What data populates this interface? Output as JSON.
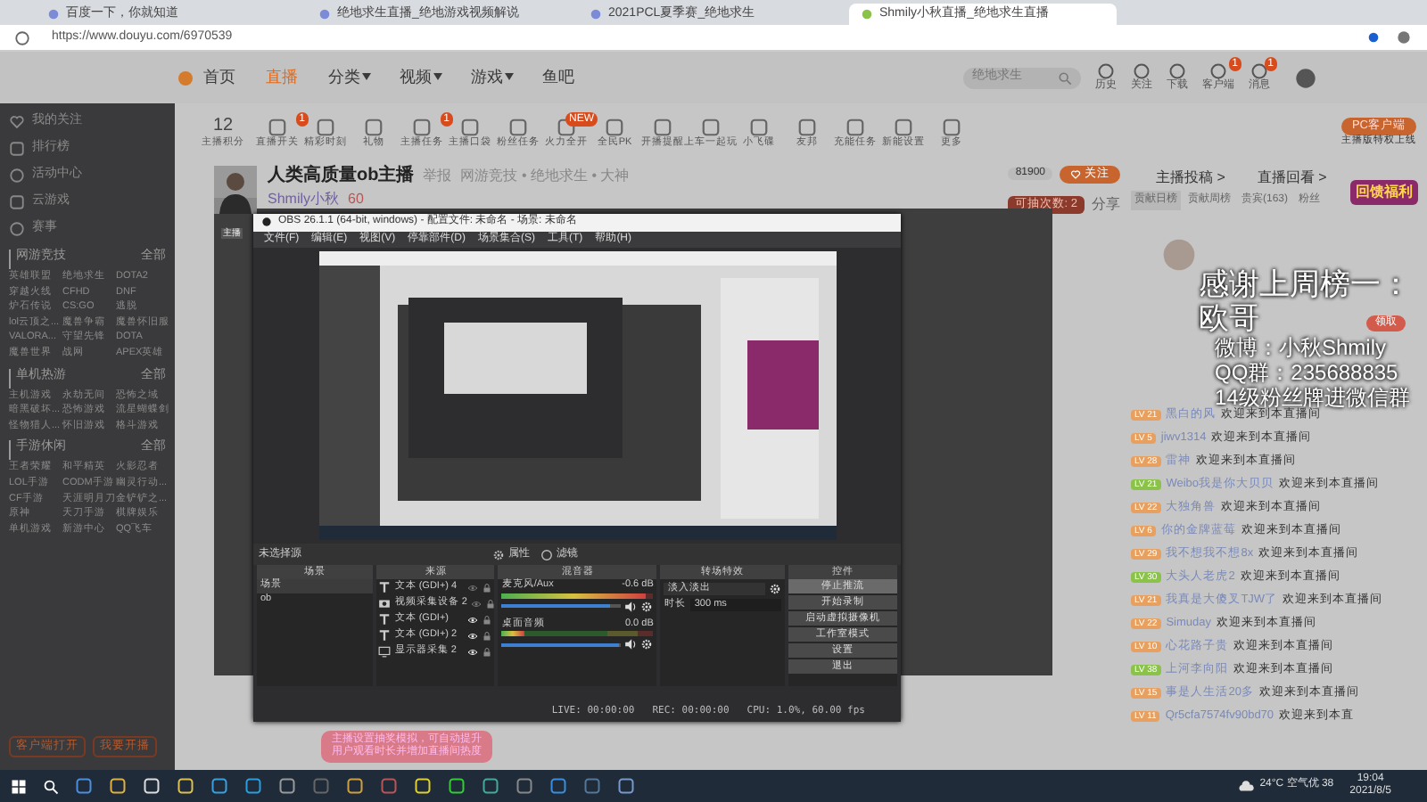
{
  "browser": {
    "tabs": [
      {
        "title": "百度一下，你就知道",
        "selected": false
      },
      {
        "title": "绝地求生直播_绝地游戏视频解说",
        "selected": false
      },
      {
        "title": "2021PCL夏季赛_绝地求生",
        "selected": false
      },
      {
        "title": "Shmily小秋直播_绝地求生直播",
        "selected": true
      }
    ],
    "url": "https://www.douyu.com/6970539"
  },
  "header": {
    "nav": [
      {
        "label": "首页",
        "selected": false,
        "dropdown": false
      },
      {
        "label": "直播",
        "selected": true,
        "dropdown": false
      },
      {
        "label": "分类",
        "selected": false,
        "dropdown": true
      },
      {
        "label": "视频",
        "selected": false,
        "dropdown": true
      },
      {
        "label": "游戏",
        "selected": false,
        "dropdown": true
      },
      {
        "label": "鱼吧",
        "selected": false,
        "dropdown": false
      }
    ],
    "search_placeholder": "绝地求生",
    "actions": [
      {
        "label": "历史"
      },
      {
        "label": "关注"
      },
      {
        "label": "下载"
      },
      {
        "label": "客户端",
        "badge": "1"
      },
      {
        "label": "消息",
        "badge": "1"
      }
    ]
  },
  "sidebar": {
    "links": [
      "我的关注",
      "排行榜",
      "活动中心",
      "云游戏",
      "赛事"
    ],
    "sections": [
      {
        "title": "网游竞技",
        "more": "全部",
        "items": [
          "英雄联盟",
          "绝地求生",
          "DOTA2",
          "穿越火线",
          "CFHD",
          "DNF",
          "炉石传说",
          "CS:GO",
          "逃脱",
          "lol云顶之...",
          "魔兽争霸",
          "魔兽怀旧服",
          "VALORA...",
          "守望先锋",
          "DOTA",
          "魔兽世界",
          "战网",
          "APEX英雄"
        ]
      },
      {
        "title": "单机热游",
        "more": "全部",
        "items": [
          "主机游戏",
          "永劫无间",
          "恐怖之域",
          "暗黑破坏...",
          "恐怖游戏",
          "流星蝴蝶剑",
          "怪物猎人...",
          "怀旧游戏",
          "格斗游戏"
        ]
      },
      {
        "title": "手游休闲",
        "more": "全部",
        "items": [
          "王者荣耀",
          "和平精英",
          "火影忍者",
          "LOL手游",
          "CODM手游",
          "幽灵行动...",
          "CF手游",
          "天涯明月刀",
          "金铲铲之...",
          "原神",
          "天刀手游",
          "棋牌娱乐",
          "单机游戏",
          "新游中心",
          "QQ飞车"
        ]
      }
    ],
    "buttons": [
      "客户端打开",
      "我要开播"
    ]
  },
  "toolbar": {
    "score": "12",
    "score_label": "主播积分",
    "tools": [
      {
        "label": "直播开关",
        "badge": "1"
      },
      {
        "label": "精彩时刻"
      },
      {
        "label": "礼物"
      },
      {
        "label": "主播任务",
        "badge": "1"
      },
      {
        "label": "主播口袋"
      },
      {
        "label": "粉丝任务"
      },
      {
        "label": "火力全开",
        "badge": "NEW"
      },
      {
        "label": "全民PK"
      },
      {
        "label": "开播提醒"
      },
      {
        "label": "上车一起玩"
      },
      {
        "label": "小飞碟"
      },
      {
        "label": "友邦"
      },
      {
        "label": "充能任务"
      },
      {
        "label": "新能设置"
      },
      {
        "label": "更多"
      }
    ],
    "client_button": "PC客户端",
    "client_note": "主播版特权上线"
  },
  "streamer": {
    "name": "人类高质量ob主播",
    "report": "举报",
    "category": "网游竞技 • 绝地求生 • 大神",
    "anchor": "Shmily小秋",
    "level": "60",
    "avatar_label": "主播",
    "follow_count": "81900",
    "follow_button": "关注",
    "lottery_button": "可抽次数: 2",
    "share": "分享"
  },
  "obs": {
    "title": "OBS 26.1.1 (64-bit, windows) - 配置文件: 未命名 - 场景: 未命名",
    "menu": [
      "文件(F)",
      "编辑(E)",
      "视图(V)",
      "停靠部件(D)",
      "场景集合(S)",
      "工具(T)",
      "帮助(H)"
    ],
    "source_bar": {
      "label": "未选择源",
      "properties": "属性",
      "filters": "滤镜"
    },
    "docks": {
      "scenes": {
        "title": "场景",
        "items": [
          {
            "label": "场景",
            "selected": true
          },
          {
            "label": "ob",
            "selected": false
          }
        ]
      },
      "sources": {
        "title": "来源",
        "items": [
          {
            "label": "文本 (GDI+) 4",
            "kind": "text",
            "visible": false
          },
          {
            "label": "视频采集设备 2",
            "kind": "camera",
            "visible": false
          },
          {
            "label": "文本 (GDI+)",
            "kind": "text",
            "visible": true
          },
          {
            "label": "文本 (GDI+) 2",
            "kind": "text",
            "visible": true
          },
          {
            "label": "显示器采集 2",
            "kind": "monitor",
            "visible": true
          }
        ]
      },
      "mixer": {
        "title": "混音器",
        "channels": [
          {
            "name": "麦克风/Aux",
            "reading": "-0.6 dB",
            "meter": {
              "level": 0.95
            },
            "volume": {
              "level": 0.9
            }
          },
          {
            "name": "桌面音频",
            "reading": "0.0 dB",
            "meter": {
              "level": 0.15
            },
            "volume": {
              "level": 0.98
            }
          }
        ]
      },
      "transitions": {
        "title": "转场特效",
        "transition": "淡入淡出",
        "duration_label": "时长",
        "duration": "300 ms"
      },
      "controls": {
        "title": "控件",
        "buttons": [
          {
            "label": "停止推流",
            "active": true
          },
          {
            "label": "开始录制",
            "active": false
          },
          {
            "label": "启动虚拟摄像机",
            "active": false
          },
          {
            "label": "工作室模式",
            "active": false
          },
          {
            "label": "设置",
            "active": false
          },
          {
            "label": "退出",
            "active": false
          }
        ]
      }
    },
    "status": {
      "live": "LIVE: 00:00:00",
      "rec": "REC: 00:00:00",
      "cpu": "CPU: 1.0%, 60.00 fps"
    }
  },
  "tooltip": [
    "主播设置抽奖模拟，可自动提升",
    "用户观看时长并增加直播间热度"
  ],
  "chat": {
    "links": [
      "主播投稿 >",
      "直播回看 >"
    ],
    "tabs": [
      {
        "label": "贡献日榜",
        "selected": true
      },
      {
        "label": "贡献周榜",
        "selected": false
      },
      {
        "label": "贵宾(163)",
        "selected": false
      },
      {
        "label": "粉丝",
        "selected": false
      }
    ],
    "messages": [
      {
        "level": "LV 21",
        "color": "#e8a060",
        "name": "黑白的风",
        "text": "欢迎来到本直播间"
      },
      {
        "level": "LV 5",
        "color": "#e8a060",
        "name": "jiwv1314",
        "text": "欢迎来到本直播间"
      },
      {
        "level": "LV 28",
        "color": "#e8a060",
        "name": "雷神",
        "text": "欢迎来到本直播间"
      },
      {
        "level": "LV 21",
        "color": "#8bc34a",
        "name": "Weibo我是你大贝贝",
        "text": "欢迎来到本直播间"
      },
      {
        "level": "LV 22",
        "color": "#e8a060",
        "name": "大独角兽",
        "text": "欢迎来到本直播间"
      },
      {
        "level": "LV 6",
        "color": "#e8a060",
        "name": "你的金牌蓝莓",
        "text": "欢迎来到本直播间"
      },
      {
        "level": "LV 29",
        "color": "#e8a060",
        "name": "我不想我不想8x",
        "text": "欢迎来到本直播间"
      },
      {
        "level": "LV 30",
        "color": "#8bc34a",
        "name": "大头人老虎2",
        "text": "欢迎来到本直播间"
      },
      {
        "level": "LV 21",
        "color": "#e8a060",
        "name": "我真是大傻叉TJW了",
        "text": "欢迎来到本直播间"
      },
      {
        "level": "LV 22",
        "color": "#e8a060",
        "name": "Simuday",
        "text": "欢迎来到本直播间"
      },
      {
        "level": "LV 10",
        "color": "#e8a060",
        "name": "心花路子贵",
        "text": "欢迎来到本直播间"
      },
      {
        "level": "LV 38",
        "color": "#8bc34a",
        "name": "上河李向阳",
        "text": "欢迎来到本直播间"
      },
      {
        "level": "LV 15",
        "color": "#e8a060",
        "name": "事是人生活20多",
        "text": "欢迎来到本直播间"
      },
      {
        "level": "LV 11",
        "color": "#e8a060",
        "name": "Qr5cfa7574fv90bd70",
        "text": "欢迎来到本直"
      }
    ],
    "promo": "回馈福利",
    "promo_button": "领取"
  },
  "overlay": [
    "感谢上周榜一：",
    "欧哥",
    "微博：小秋Shmily",
    "QQ群：235688835",
    "14级粉丝牌进微信群"
  ],
  "taskbar": {
    "weather": "24°C 空气优 38",
    "time": "19:04",
    "date": "2021/8/5"
  }
}
